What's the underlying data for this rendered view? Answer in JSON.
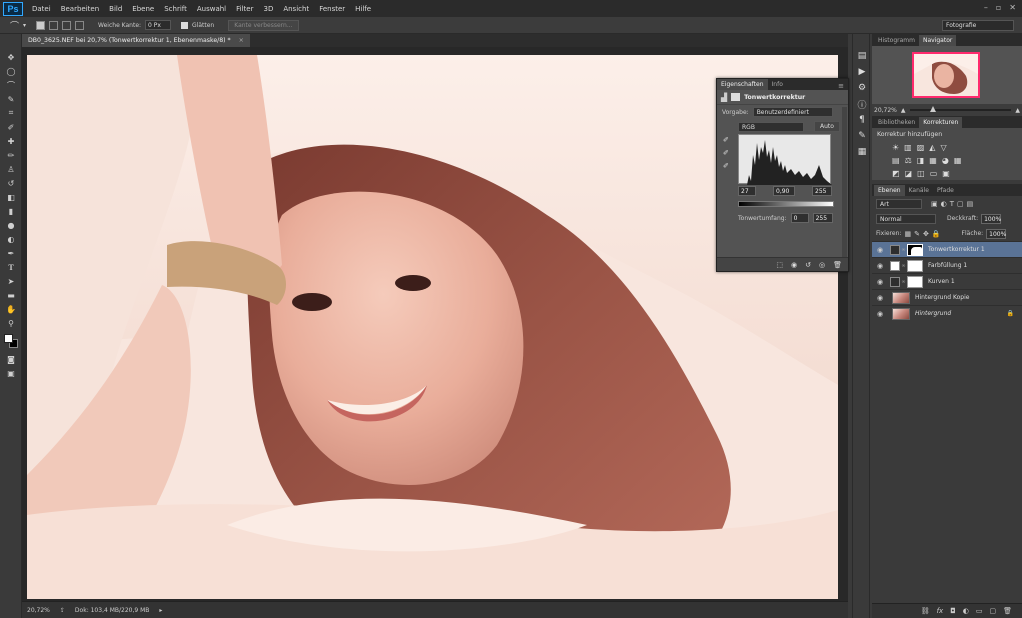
{
  "app": {
    "logo": "Ps"
  },
  "menu": [
    "Datei",
    "Bearbeiten",
    "Bild",
    "Ebene",
    "Schrift",
    "Auswahl",
    "Filter",
    "3D",
    "Ansicht",
    "Fenster",
    "Hilfe"
  ],
  "options": {
    "feather_label": "Weiche Kante:",
    "feather_value": "0 Px",
    "antialias_label": "Glätten",
    "refine_button": "Kante verbessern...",
    "workspace": "Fotografie"
  },
  "document": {
    "tab_title": "DB0_3625.NEF bei 20,7% (Tonwertkorrektur 1, Ebenenmaske/8) *",
    "close": "×"
  },
  "status": {
    "zoom": "20,72%",
    "doc_info": "Dok: 103,4 MB/220,9 MB"
  },
  "navigator": {
    "tabs": [
      "Histogramm",
      "Navigator"
    ],
    "zoom": "20,72%"
  },
  "corrections": {
    "tabs": [
      "Bibliotheken",
      "Korrekturen"
    ],
    "title": "Korrektur hinzufügen",
    "row1_icons": [
      "☀",
      "▥",
      "▨",
      "◭",
      "▽"
    ],
    "row2_icons": [
      "▤",
      "⚖",
      "◨",
      "▦",
      "◕",
      "▦"
    ],
    "row3_icons": [
      "◩",
      "◪",
      "◫",
      "▭",
      "▣"
    ]
  },
  "layers": {
    "tabs": [
      "Ebenen",
      "Kanäle",
      "Pfade"
    ],
    "filter_kind": "Art",
    "blend_mode": "Normal",
    "opacity_label": "Deckkraft:",
    "opacity_value": "100%",
    "lock_label": "Fixieren:",
    "fill_label": "Fläche:",
    "fill_value": "100%",
    "items": [
      {
        "name": "Tonwertkorrektur 1",
        "selected": true
      },
      {
        "name": "Farbfüllung 1"
      },
      {
        "name": "Kurven 1"
      },
      {
        "name": "Hintergrund Kopie"
      },
      {
        "name": "Hintergrund"
      }
    ]
  },
  "properties": {
    "tabs": [
      "Eigenschaften",
      "Info"
    ],
    "title": "Tonwertkorrektur",
    "preset_label": "Vorgabe:",
    "preset_value": "Benutzerdefiniert",
    "channel": "RGB",
    "auto_button": "Auto",
    "input_black": "27",
    "input_gamma": "0,90",
    "input_white": "255",
    "output_label": "Tonwertumfang:",
    "output_black": "0",
    "output_white": "255"
  },
  "colors": {
    "accent_selected_layer": "#5a7396",
    "navigator_frame": "#ff2a6d",
    "ps_blue": "#31a8ff"
  }
}
